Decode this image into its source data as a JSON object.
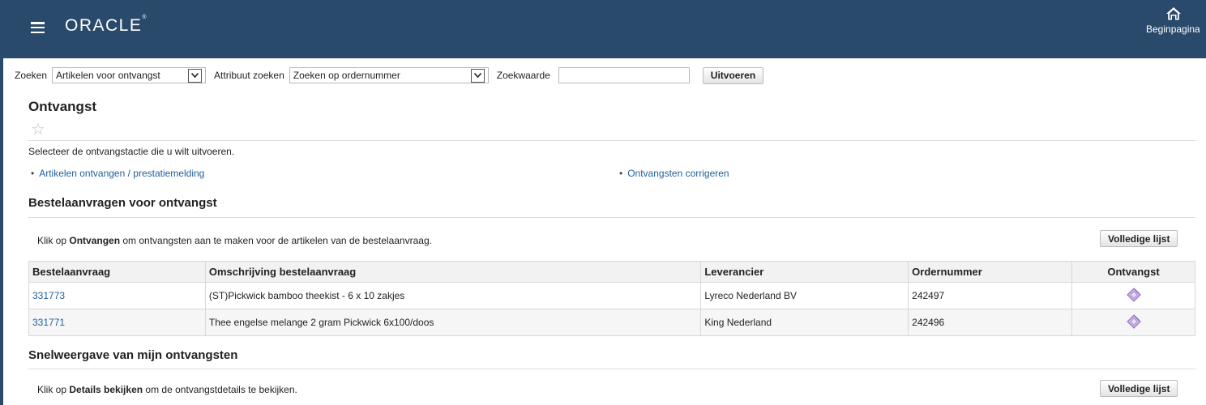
{
  "header": {
    "logo_text": "ORACLE",
    "logo_mark": "®",
    "home_label": "Beginpagina",
    "menu_icon": "hamburger-icon",
    "home_icon": "home-icon",
    "brand_color": "#2a4a6b"
  },
  "search": {
    "search_label": "Zoeken",
    "search_scope": "Artikelen voor ontvangst",
    "attribute_label": "Attribuut zoeken",
    "attribute_value": "Zoeken op ordernummer",
    "value_label": "Zoekwaarde",
    "value_input": "",
    "go_button": "Uitvoeren"
  },
  "page": {
    "title": "Ontvangst",
    "favorite_icon": "star-icon",
    "instruction": "Selecteer de ontvangstactie die u wilt uitvoeren.",
    "actions": [
      {
        "label": "Artikelen ontvangen / prestatiemelding"
      },
      {
        "label": "Ontvangsten corrigeren"
      }
    ]
  },
  "requisitions": {
    "title": "Bestelaanvragen voor ontvangst",
    "tip_prefix": "Klik op ",
    "tip_bold": "Ontvangen",
    "tip_suffix": " om ontvangsten aan te maken voor de artikelen van de bestelaanvraag.",
    "full_list_button": "Volledige lijst",
    "columns": [
      "Bestelaanvraag",
      "Omschrijving bestelaanvraag",
      "Leverancier",
      "Ordernummer",
      "Ontvangst"
    ],
    "rows": [
      {
        "requisition": "331773",
        "description": "(ST)Pickwick bamboo theekist - 6 x 10 zakjes",
        "supplier": "Lyreco Nederland BV",
        "order_number": "242497",
        "receive_icon": "receive-icon"
      },
      {
        "requisition": "331771",
        "description": "Thee engelse melange 2 gram Pickwick 6x100/doos",
        "supplier": "King Nederland",
        "order_number": "242496",
        "receive_icon": "receive-icon"
      }
    ]
  },
  "my_receipts": {
    "title": "Snelweergave van mijn ontvangsten",
    "tip_prefix": "Klik op ",
    "tip_bold": "Details bekijken",
    "tip_suffix": " om de ontvangstdetails te bekijken.",
    "full_list_button": "Volledige lijst"
  }
}
